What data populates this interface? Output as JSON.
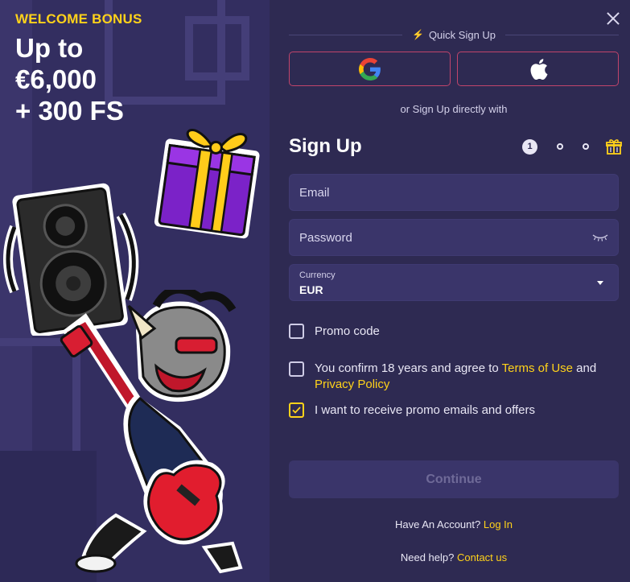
{
  "promo": {
    "kicker": "WELCOME BONUS",
    "headline_line1": "Up to",
    "headline_line2": "€6,000",
    "headline_line3": "+ 300 FS"
  },
  "quick_signup": {
    "label": "Quick Sign Up",
    "icon": "bolt-icon"
  },
  "social": {
    "google_icon": "google-icon",
    "apple_icon": "apple-icon"
  },
  "divider_text": "or Sign Up directly with",
  "signup": {
    "title": "Sign Up",
    "current_step": "1",
    "step_icon_final": "gift-icon"
  },
  "fields": {
    "email_placeholder": "Email",
    "password_placeholder": "Password",
    "currency_label": "Currency",
    "currency_value": "EUR"
  },
  "checkboxes": {
    "promo_code": {
      "label": "Promo code",
      "checked": false
    },
    "terms": {
      "prefix": "You confirm 18 years and agree to ",
      "terms_link": "Terms of Use",
      "middle": " and ",
      "privacy_link": "Privacy Policy",
      "checked": false
    },
    "emails": {
      "label": "I want to receive promo emails and offers",
      "checked": true
    }
  },
  "continue_label": "Continue",
  "account": {
    "text": "Have An Account?",
    "link": "Log In"
  },
  "help": {
    "text": "Need help?",
    "link": "Contact us"
  },
  "colors": {
    "accent": "#ffd21a",
    "panel_bg": "#2e2a52",
    "field_bg": "#3a356a",
    "social_border": "#c1446b"
  }
}
